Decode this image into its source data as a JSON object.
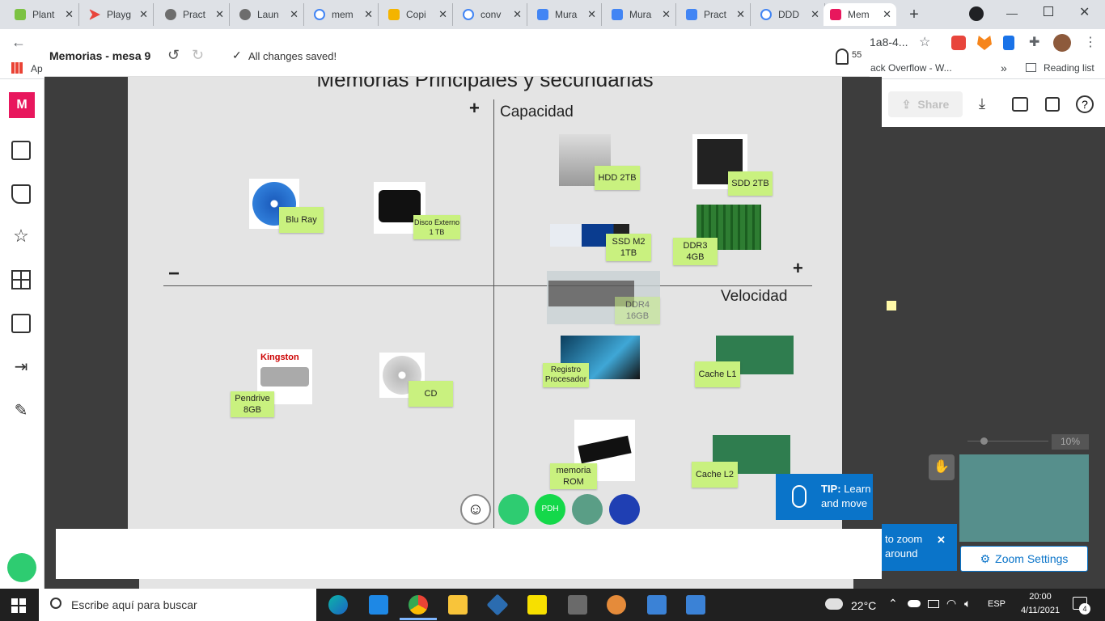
{
  "browser": {
    "tabs": [
      {
        "title": "Plant",
        "color": "#7cc243"
      },
      {
        "title": "Playg",
        "color": "#e8453c"
      },
      {
        "title": "Pract",
        "color": "#6d6d6d"
      },
      {
        "title": "Laun",
        "color": "#6d6d6d"
      },
      {
        "title": "mem",
        "color": "#4285f4"
      },
      {
        "title": "Copi",
        "color": "#f4b400"
      },
      {
        "title": "conv",
        "color": "#4285f4"
      },
      {
        "title": "Mura",
        "color": "#4285f4"
      },
      {
        "title": "Mura",
        "color": "#4285f4"
      },
      {
        "title": "Pract",
        "color": "#4285f4"
      },
      {
        "title": "DDD",
        "color": "#4285f4"
      },
      {
        "title": "Mem",
        "color": "#e8175d"
      }
    ],
    "url_fragment": "1a8-4...",
    "bookmarks": {
      "apps": "Ap",
      "stack": "ack Overflow - W...",
      "more": "»",
      "reading_list": "Reading list"
    }
  },
  "mural": {
    "title": "Memorias - mesa 9",
    "saved_status": "All changes saved!",
    "user_count": "55",
    "share_label": "Share",
    "board_title": "Memorias Principales y secundarias",
    "axis_y_label": "Capacidad",
    "axis_x_label": "Velocidad",
    "plus_y": "+",
    "plus_x": "+",
    "minus_x": "−",
    "stickies": {
      "hdd": "HDD 2TB",
      "sdd": "SDD 2TB",
      "bluray": "Blu Ray",
      "disco": "Disco Externo 1 TB",
      "ssdm2": "SSD M2 1TB",
      "ddr3": "DDR3 4GB",
      "ddr4": "DDR4 16GB",
      "pendrive": "Pendrive 8GB",
      "cd": "CD",
      "registro": "Registro Procesador",
      "cachel1": "Cache L1",
      "rom": "memoria ROM",
      "cachel2": "Cache L2"
    },
    "avatar_pdh": "PDH",
    "zoom_level": "10%",
    "tip_bold": "TIP:",
    "tip_text": "Learn",
    "tip_text2": "and move",
    "tip_more": "to zoom around",
    "zoom_settings": "Zoom Settings"
  },
  "taskbar": {
    "search_placeholder": "Escribe aquí para buscar",
    "weather": "22°C",
    "lang": "ESP",
    "time": "20:00",
    "date": "4/11/2021",
    "notif_count": "4"
  }
}
